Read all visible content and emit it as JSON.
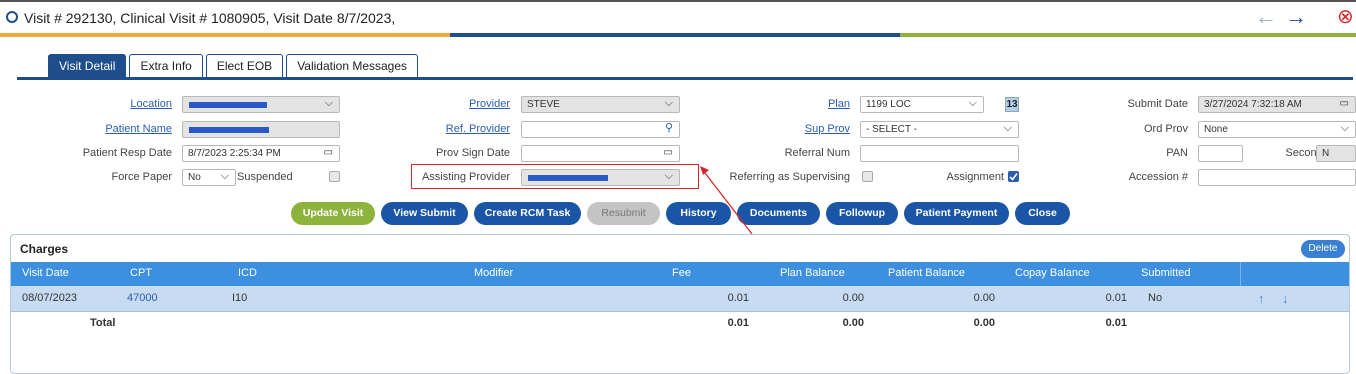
{
  "title": {
    "text": "Visit # 292130, Clinical Visit # 1080905, Visit Date 8/7/2023,",
    "back_icon": "←",
    "forward_icon": "→",
    "close_icon": "⊗"
  },
  "tabs": [
    {
      "label": "Visit Detail"
    },
    {
      "label": "Extra Info"
    },
    {
      "label": "Elect EOB"
    },
    {
      "label": "Validation Messages"
    }
  ],
  "form": {
    "location": {
      "label": "Location",
      "value": ""
    },
    "patient_name": {
      "label": "Patient Name",
      "value": ""
    },
    "patient_resp_date": {
      "label": "Patient Resp Date",
      "value": "8/7/2023 2:25:34 PM"
    },
    "force_paper": {
      "label": "Force Paper",
      "value": "No"
    },
    "suspended": {
      "label": "Suspended"
    },
    "provider": {
      "label": "Provider",
      "value": "STEVE"
    },
    "ref_provider": {
      "label": "Ref. Provider",
      "value": ""
    },
    "prov_sign_date": {
      "label": "Prov Sign Date",
      "value": ""
    },
    "assisting_provider": {
      "label": "Assisting Provider",
      "value": ""
    },
    "plan": {
      "label": "Plan",
      "value": "1199 LOC",
      "badge": "13"
    },
    "sup_prov": {
      "label": "Sup Prov",
      "value": "- SELECT -"
    },
    "referral_num": {
      "label": "Referral Num",
      "value": ""
    },
    "referring_as_supervising": {
      "label": "Referring as Supervising"
    },
    "assignment": {
      "label": "Assignment"
    },
    "submit_date": {
      "label": "Submit Date",
      "value": "3/27/2024 7:32:18 AM"
    },
    "ord_prov": {
      "label": "Ord Prov",
      "value": "None"
    },
    "pan": {
      "label": "PAN",
      "value": ""
    },
    "secondary": {
      "label": "Secondary",
      "value": "N"
    },
    "accession": {
      "label": "Accession #",
      "value": ""
    }
  },
  "buttons": {
    "update_visit": "Update Visit",
    "view_submit": "View Submit",
    "create_rcm_task": "Create RCM Task",
    "resubmit": "Resubmit",
    "history": "History",
    "documents": "Documents",
    "followup": "Followup",
    "patient_payment": "Patient Payment",
    "close": "Close"
  },
  "charges": {
    "title": "Charges",
    "delete_label": "Delete",
    "columns": [
      "Visit Date",
      "CPT",
      "ICD",
      "Modifier",
      "Fee",
      "Plan Balance",
      "Patient Balance",
      "Copay Balance",
      "Submitted"
    ],
    "row": {
      "visit_date": "08/07/2023",
      "cpt": "47000",
      "icd": "I10",
      "modifier": "",
      "fee": "0.01",
      "plan_balance": "0.00",
      "patient_balance": "0.00",
      "copay_balance": "0.01",
      "submitted": "No",
      "up_icon": "↑",
      "down_icon": "↓"
    },
    "total": {
      "label": "Total",
      "fee": "0.01",
      "plan_balance": "0.00",
      "patient_balance": "0.00",
      "copay_balance": "0.01"
    }
  },
  "colors": {
    "accent": "#1f4e8c",
    "button_blue": "#1a55a6",
    "button_green": "#8db33c",
    "table_header": "#3d8fe0",
    "selected_row": "#c7dcf2",
    "annotation_red": "#d9262e"
  }
}
